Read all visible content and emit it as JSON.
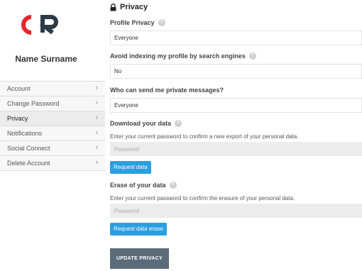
{
  "brand": {
    "logo_text": "CR",
    "logo_color": "#e8262b",
    "logo_dark": "#2d3b47"
  },
  "user": {
    "name": "Name Surname"
  },
  "menu": [
    {
      "label": "Account"
    },
    {
      "label": "Change Password"
    },
    {
      "label": "Privacy",
      "active": true
    },
    {
      "label": "Notifications"
    },
    {
      "label": "Social Connect"
    },
    {
      "label": "Delete Account"
    }
  ],
  "privacy": {
    "title": "Privacy",
    "profile_privacy": {
      "label": "Profile Privacy",
      "value": "Everyone"
    },
    "avoid_indexing": {
      "label": "Avoid indexing my profile by search engines",
      "value": "No"
    },
    "private_messages": {
      "label": "Who can send me private messages?",
      "value": "Everyone"
    },
    "download": {
      "label": "Download your data",
      "description": "Enter your current password to confirm a new export of your personal data.",
      "placeholder": "Password",
      "button": "Request data"
    },
    "erase": {
      "label": "Erase of your data",
      "description": "Enter your current password to confirm the erasure of your personal data.",
      "placeholder": "Password",
      "button": "Request data erase"
    },
    "submit": "UPDATE PRIVACY"
  },
  "help_glyph": "?",
  "chevron_glyph": "›",
  "accent": "#2a9fe0"
}
